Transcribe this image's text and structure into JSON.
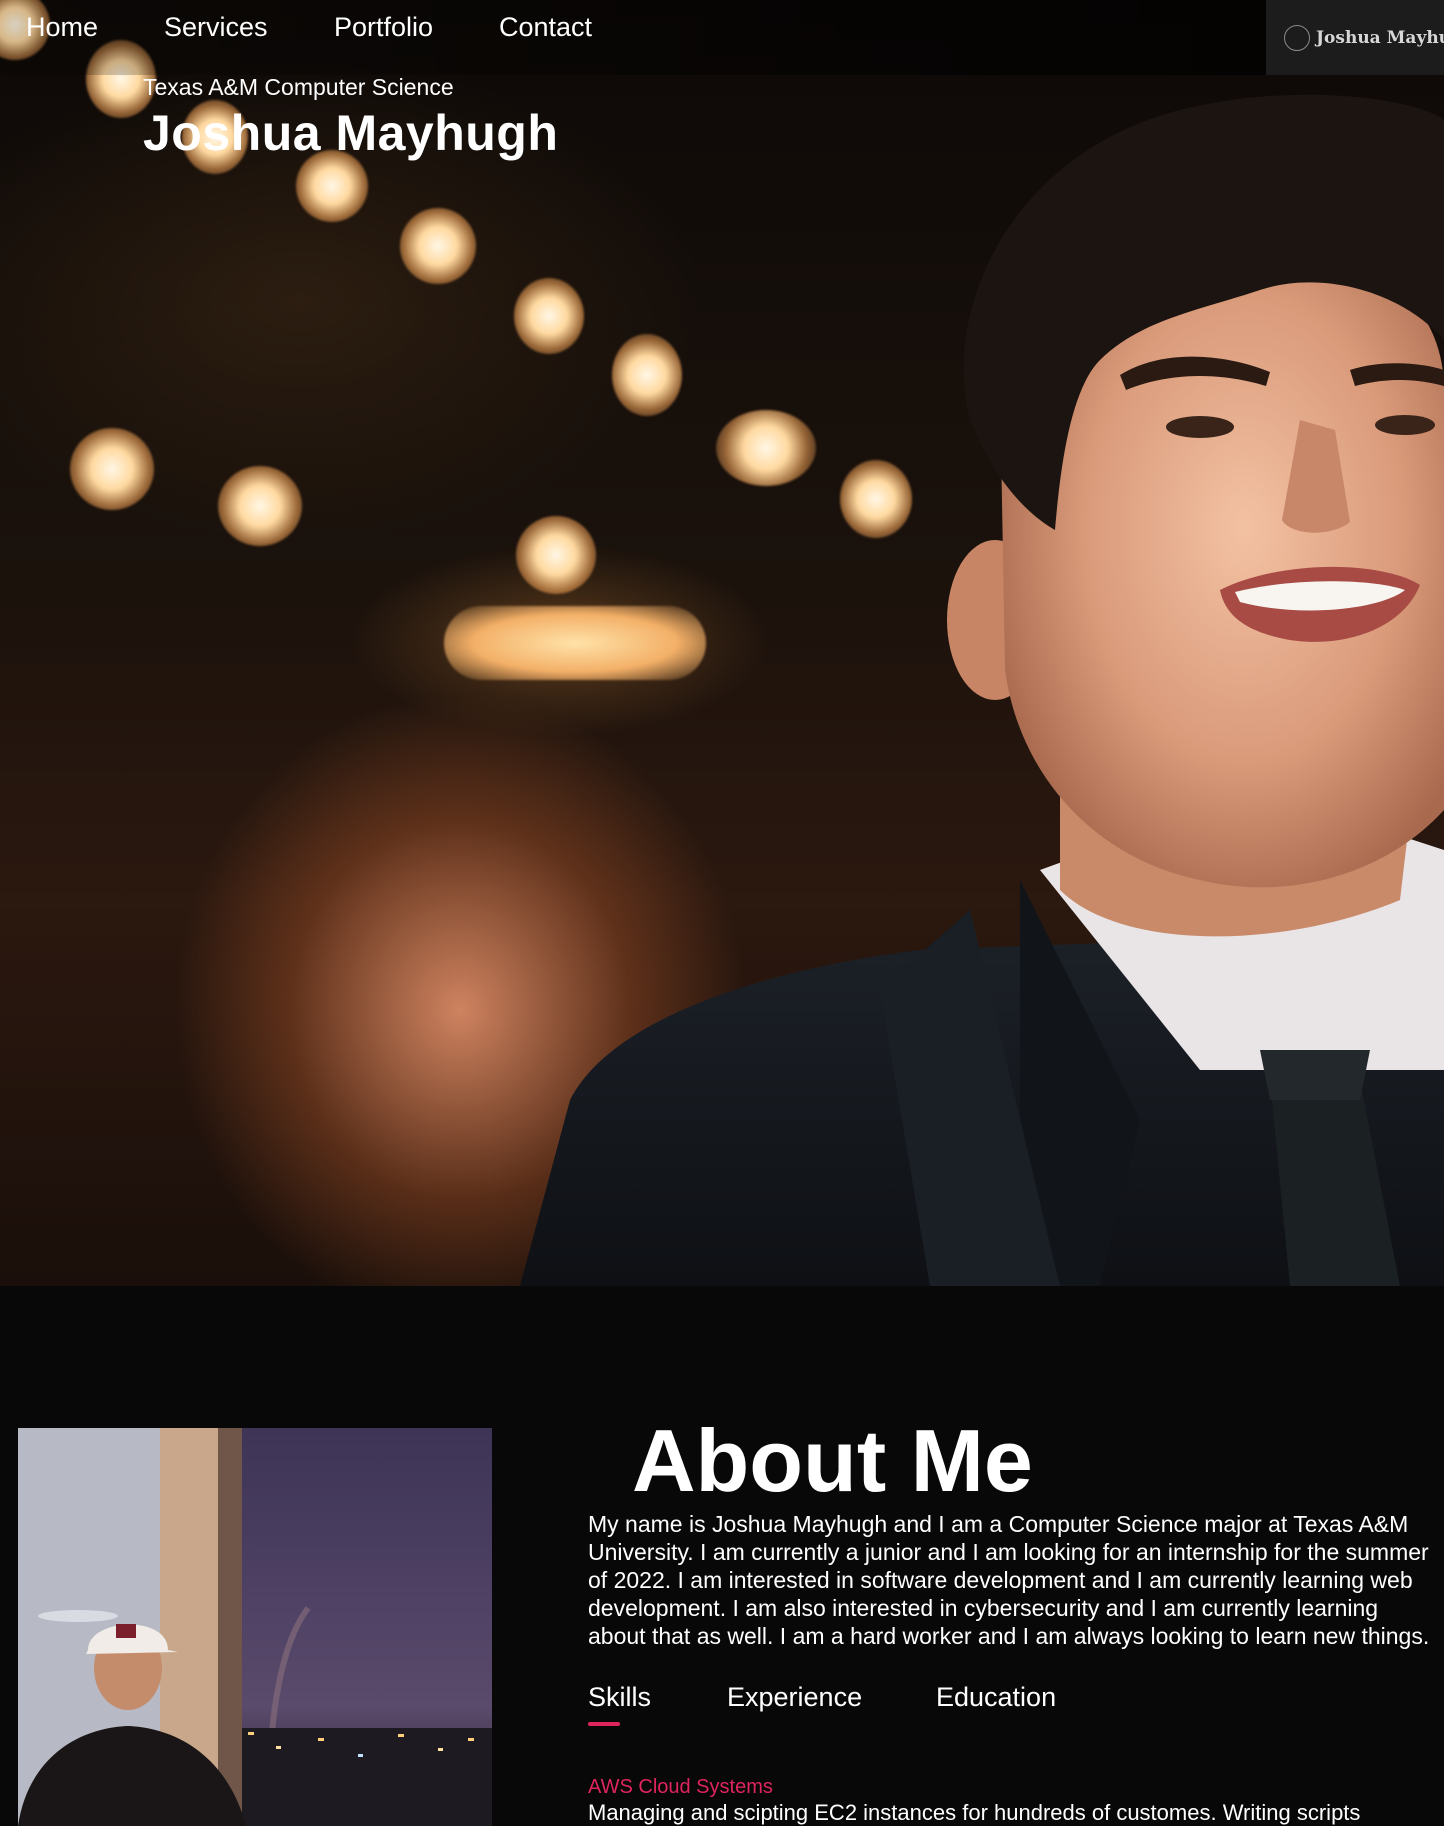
{
  "nav": {
    "items": [
      {
        "label": "Home"
      },
      {
        "label": "Services"
      },
      {
        "label": "Portfolio"
      },
      {
        "label": "Contact"
      }
    ],
    "brand": "Joshua Mayhugh"
  },
  "hero": {
    "subtitle": "Texas A&M Computer Science",
    "title": "Joshua Mayhugh"
  },
  "about": {
    "heading": "About Me",
    "paragraph_lines": [
      "My name is Joshua Mayhugh and I am a Computer Science major at Texas A&M",
      "University. I am currently a junior and I am looking for an internship for the summer",
      "of 2022. I am interested in software development and I am currently learning web",
      "development. I am also interested in cybersecurity and I am currently learning",
      "about that as well. I am a hard worker and I am always looking to learn new things."
    ],
    "tabs": [
      {
        "label": "Skills"
      },
      {
        "label": "Experience"
      },
      {
        "label": "Education"
      }
    ],
    "active_tab": "Skills",
    "skill": {
      "title": "AWS Cloud Systems",
      "description": "Managing and scipting EC2 instances for hundreds of customes. Writing scripts"
    }
  },
  "colors": {
    "accent": "#e0245e",
    "background": "#080808",
    "brand_box": "#1c1c1c"
  }
}
